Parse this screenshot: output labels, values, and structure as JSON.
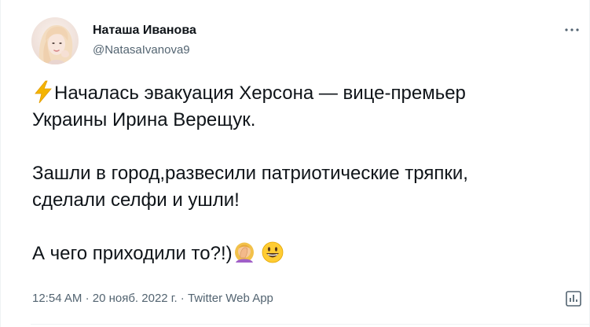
{
  "author": {
    "display_name": "Наташа Иванова",
    "handle": "@NatasaIvanova9"
  },
  "tweet": {
    "line1_text": "Началась эвакуация Херсона — вице-премьер",
    "line2_text": "Украины Ирина Верещук.",
    "line3_text": "Зашли в город,развесили патриотические тряпки,",
    "line4_text": "сделали селфи и ушли!",
    "line5_text": "А чего приходили то?!)",
    "emojis": [
      "lightning-icon",
      "woman-facepalming-icon",
      "grinning-face-icon"
    ]
  },
  "meta": {
    "time": "12:54 AM",
    "separator": "·",
    "date": "20 нояб. 2022 г.",
    "source": "Twitter Web App"
  },
  "colors": {
    "text_primary": "#0f1419",
    "text_secondary": "#536471",
    "divider": "#eff3f4",
    "lightning": "#f4b400",
    "emoji_face": "#ffcc33"
  }
}
